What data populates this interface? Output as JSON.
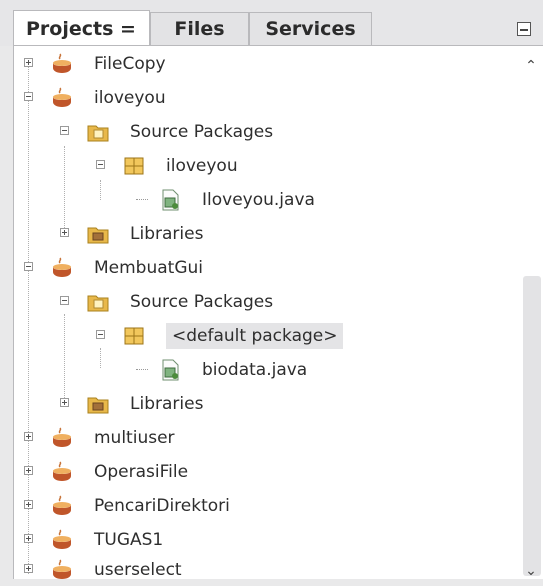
{
  "tabs": [
    {
      "label": "Projects  ="
    },
    {
      "label": "Files"
    },
    {
      "label": "Services"
    }
  ],
  "tree": {
    "fileCopy": "FileCopy",
    "iloveyou": "iloveyou",
    "iloveyouSource": "Source Packages",
    "iloveyouPackage": "iloveyou",
    "iloveyouFile": "Iloveyou.java",
    "iloveyouLibraries": "Libraries",
    "membuatGui": "MembuatGui",
    "membuatSource": "Source Packages",
    "membuatPackage": "<default package>",
    "membuatFile": "biodata.java",
    "membuatLibraries": "Libraries",
    "multiuser": "multiuser",
    "operasiFile": "OperasiFile",
    "pencariDirektori": "PencariDirektori",
    "tugas1": "TUGAS1",
    "userselect": "userselect"
  },
  "icons": {
    "project": "coffee-cup-icon",
    "folder": "folder-icon",
    "package": "package-icon",
    "javaFile": "java-file-icon"
  }
}
